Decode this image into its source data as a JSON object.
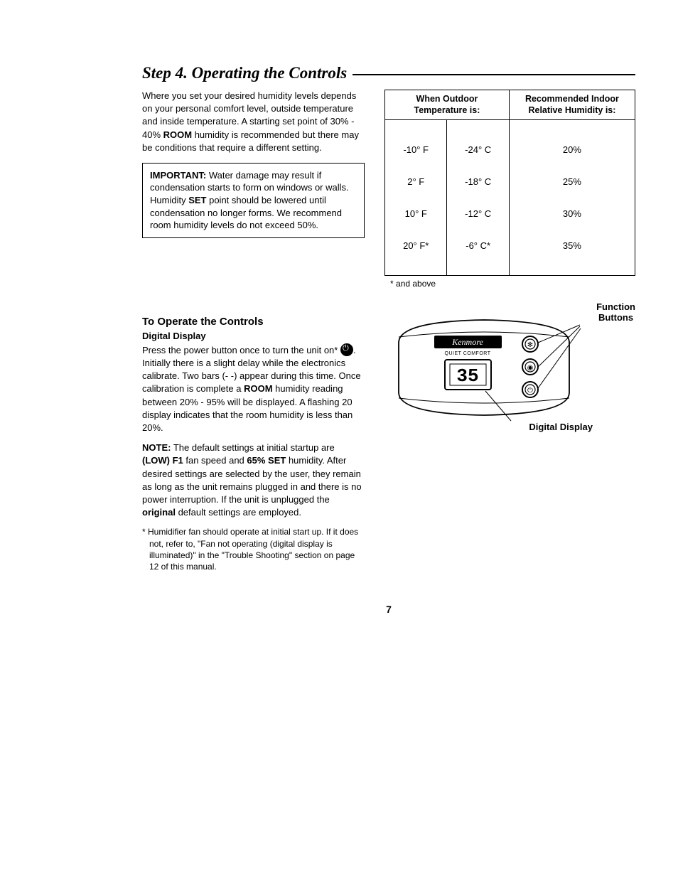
{
  "heading": "Step 4. Operating the Controls",
  "intro": {
    "l1": "Where you set your desired humidity",
    "l2": "levels depends on your personal comfort",
    "l3": "level, outside temperature and inside",
    "l4a": "temperature. A starting set point of 30% -",
    "l4b": "40% ",
    "l4c": "ROOM",
    "l4d": " humidity is recommended",
    "l5": "but there may be conditions that require a",
    "l6": "different setting."
  },
  "important": {
    "label": "IMPORTANT:",
    "text": " Water damage may result if condensation starts to form on windows or walls. Humidity ",
    "set": "SET",
    "text2": " point should be lowered until condensation no longer forms. We recommend room humidity levels do not exceed 50%."
  },
  "table": {
    "h1": "When Outdoor\nTemperature is:",
    "h2": "Recommended Indoor\nRelative Humidity is:",
    "rows": [
      {
        "f": "-10° F",
        "c": "-24° C",
        "h": "20%"
      },
      {
        "f": "2° F",
        "c": "-18° C",
        "h": "25%"
      },
      {
        "f": "10° F",
        "c": "-12° C",
        "h": "30%"
      },
      {
        "f": "20° F*",
        "c": "-6° C*",
        "h": "35%"
      }
    ],
    "footnote": "* and above"
  },
  "operate": {
    "title": "To Operate the Controls",
    "subtitle": "Digital Display",
    "p1a": "Press the power button once to turn the unit on*  ",
    "p1b": ".  Initially there is a slight delay while the electronics calibrate. Two bars (- -) appear during this time. Once calibration is complete a ",
    "p1c": "ROOM",
    "p1d": " humidity reading between 20% - 95% will be displayed. A flashing 20 display indicates that the room humidity is less than 20%.",
    "noteLabel": "NOTE:",
    "note1": " The default settings at initial startup are ",
    "note2": "(LOW) F1",
    "note3": " fan speed and ",
    "note4": "65% SET",
    "note5": " humidity.  After desired settings are selected by the user, they remain as long as the unit remains plugged in and there is no power interruption. If the unit is unplugged the ",
    "note6": "original",
    "note7": " default settings are employed.",
    "foot": "* Humidifier fan should operate at initial start up. If it does not, refer to, \"Fan not operating (digital display is illuminated)\" in the \"Trouble Shooting\" section on page 12 of this manual."
  },
  "diagram": {
    "labelTop": "Function\nButtons",
    "labelBottom": "Digital Display",
    "brand": "Kenmore",
    "subbrand": "QUIET COMFORT",
    "reading": "35"
  },
  "pagenum": "7"
}
